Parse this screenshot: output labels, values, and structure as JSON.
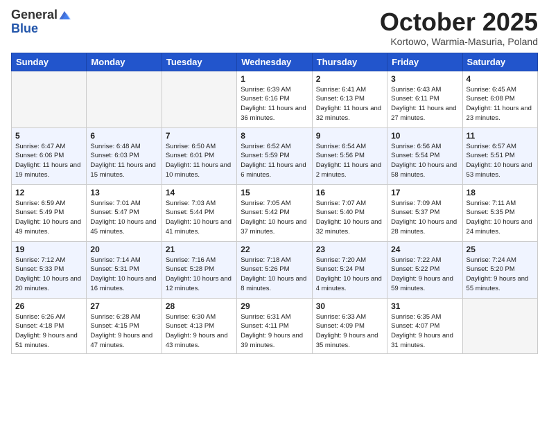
{
  "header": {
    "logo_general": "General",
    "logo_blue": "Blue",
    "month": "October 2025",
    "location": "Kortowo, Warmia-Masuria, Poland"
  },
  "days_of_week": [
    "Sunday",
    "Monday",
    "Tuesday",
    "Wednesday",
    "Thursday",
    "Friday",
    "Saturday"
  ],
  "weeks": [
    [
      {
        "day": "",
        "info": ""
      },
      {
        "day": "",
        "info": ""
      },
      {
        "day": "",
        "info": ""
      },
      {
        "day": "1",
        "info": "Sunrise: 6:39 AM\nSunset: 6:16 PM\nDaylight: 11 hours and 36 minutes."
      },
      {
        "day": "2",
        "info": "Sunrise: 6:41 AM\nSunset: 6:13 PM\nDaylight: 11 hours and 32 minutes."
      },
      {
        "day": "3",
        "info": "Sunrise: 6:43 AM\nSunset: 6:11 PM\nDaylight: 11 hours and 27 minutes."
      },
      {
        "day": "4",
        "info": "Sunrise: 6:45 AM\nSunset: 6:08 PM\nDaylight: 11 hours and 23 minutes."
      }
    ],
    [
      {
        "day": "5",
        "info": "Sunrise: 6:47 AM\nSunset: 6:06 PM\nDaylight: 11 hours and 19 minutes."
      },
      {
        "day": "6",
        "info": "Sunrise: 6:48 AM\nSunset: 6:03 PM\nDaylight: 11 hours and 15 minutes."
      },
      {
        "day": "7",
        "info": "Sunrise: 6:50 AM\nSunset: 6:01 PM\nDaylight: 11 hours and 10 minutes."
      },
      {
        "day": "8",
        "info": "Sunrise: 6:52 AM\nSunset: 5:59 PM\nDaylight: 11 hours and 6 minutes."
      },
      {
        "day": "9",
        "info": "Sunrise: 6:54 AM\nSunset: 5:56 PM\nDaylight: 11 hours and 2 minutes."
      },
      {
        "day": "10",
        "info": "Sunrise: 6:56 AM\nSunset: 5:54 PM\nDaylight: 10 hours and 58 minutes."
      },
      {
        "day": "11",
        "info": "Sunrise: 6:57 AM\nSunset: 5:51 PM\nDaylight: 10 hours and 53 minutes."
      }
    ],
    [
      {
        "day": "12",
        "info": "Sunrise: 6:59 AM\nSunset: 5:49 PM\nDaylight: 10 hours and 49 minutes."
      },
      {
        "day": "13",
        "info": "Sunrise: 7:01 AM\nSunset: 5:47 PM\nDaylight: 10 hours and 45 minutes."
      },
      {
        "day": "14",
        "info": "Sunrise: 7:03 AM\nSunset: 5:44 PM\nDaylight: 10 hours and 41 minutes."
      },
      {
        "day": "15",
        "info": "Sunrise: 7:05 AM\nSunset: 5:42 PM\nDaylight: 10 hours and 37 minutes."
      },
      {
        "day": "16",
        "info": "Sunrise: 7:07 AM\nSunset: 5:40 PM\nDaylight: 10 hours and 32 minutes."
      },
      {
        "day": "17",
        "info": "Sunrise: 7:09 AM\nSunset: 5:37 PM\nDaylight: 10 hours and 28 minutes."
      },
      {
        "day": "18",
        "info": "Sunrise: 7:11 AM\nSunset: 5:35 PM\nDaylight: 10 hours and 24 minutes."
      }
    ],
    [
      {
        "day": "19",
        "info": "Sunrise: 7:12 AM\nSunset: 5:33 PM\nDaylight: 10 hours and 20 minutes."
      },
      {
        "day": "20",
        "info": "Sunrise: 7:14 AM\nSunset: 5:31 PM\nDaylight: 10 hours and 16 minutes."
      },
      {
        "day": "21",
        "info": "Sunrise: 7:16 AM\nSunset: 5:28 PM\nDaylight: 10 hours and 12 minutes."
      },
      {
        "day": "22",
        "info": "Sunrise: 7:18 AM\nSunset: 5:26 PM\nDaylight: 10 hours and 8 minutes."
      },
      {
        "day": "23",
        "info": "Sunrise: 7:20 AM\nSunset: 5:24 PM\nDaylight: 10 hours and 4 minutes."
      },
      {
        "day": "24",
        "info": "Sunrise: 7:22 AM\nSunset: 5:22 PM\nDaylight: 9 hours and 59 minutes."
      },
      {
        "day": "25",
        "info": "Sunrise: 7:24 AM\nSunset: 5:20 PM\nDaylight: 9 hours and 55 minutes."
      }
    ],
    [
      {
        "day": "26",
        "info": "Sunrise: 6:26 AM\nSunset: 4:18 PM\nDaylight: 9 hours and 51 minutes."
      },
      {
        "day": "27",
        "info": "Sunrise: 6:28 AM\nSunset: 4:15 PM\nDaylight: 9 hours and 47 minutes."
      },
      {
        "day": "28",
        "info": "Sunrise: 6:30 AM\nSunset: 4:13 PM\nDaylight: 9 hours and 43 minutes."
      },
      {
        "day": "29",
        "info": "Sunrise: 6:31 AM\nSunset: 4:11 PM\nDaylight: 9 hours and 39 minutes."
      },
      {
        "day": "30",
        "info": "Sunrise: 6:33 AM\nSunset: 4:09 PM\nDaylight: 9 hours and 35 minutes."
      },
      {
        "day": "31",
        "info": "Sunrise: 6:35 AM\nSunset: 4:07 PM\nDaylight: 9 hours and 31 minutes."
      },
      {
        "day": "",
        "info": ""
      }
    ]
  ]
}
